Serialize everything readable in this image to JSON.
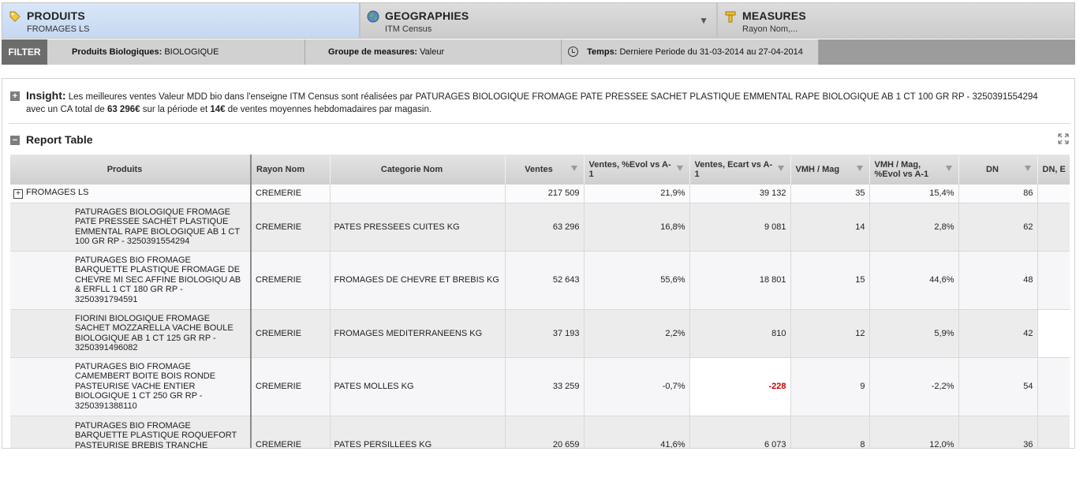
{
  "dimensions": {
    "produits": {
      "title": "PRODUITS",
      "sub": "FROMAGES LS"
    },
    "geographies": {
      "title": "GEOGRAPHIES",
      "sub": "ITM Census"
    },
    "measures": {
      "title": "MEASURES",
      "sub": "Rayon Nom,..."
    }
  },
  "filter": {
    "label": "FILTER",
    "bio_label": "Produits Biologiques:",
    "bio_value": "BIOLOGIQUE",
    "groupe_label": "Groupe de measures:",
    "groupe_value": "Valeur",
    "temps_label": "Temps:",
    "temps_value": "Derniere Periode du 31-03-2014 au 27-04-2014"
  },
  "insight": {
    "title": "Insight:",
    "text1": "Les meilleures ventes Valeur MDD bio dans l'enseigne ITM Census sont réalisées par PATURAGES BIOLOGIQUE FROMAGE PATE PRESSEE SACHET PLASTIQUE EMMENTAL RAPE BIOLOGIQUE AB 1 CT 100 GR RP - 3250391554294 avec un CA total de",
    "ca": "63 296€",
    "text2": "sur la période et",
    "weekly": "14€",
    "text3": "de ventes moyennes hebdomadaires par magasin."
  },
  "report": {
    "title": "Report Table",
    "columns": [
      "Produits",
      "Rayon Nom",
      "Categorie Nom",
      "Ventes",
      "Ventes, %Evol vs A-1",
      "Ventes, Ecart vs A-1",
      "VMH / Mag",
      "VMH / Mag, %Evol vs A-1",
      "DN",
      "DN, E"
    ],
    "top_row": {
      "produit": "FROMAGES LS",
      "rayon": "CREMERIE",
      "categorie": "",
      "ventes": "217 509",
      "evol": "21,9%",
      "ecart": "39 132",
      "vmh": "35",
      "vmh_evol": "15,4%",
      "dn": "86"
    },
    "rows": [
      {
        "produit": "PATURAGES BIOLOGIQUE FROMAGE PATE PRESSEE SACHET PLASTIQUE EMMENTAL RAPE BIOLOGIQUE AB 1 CT 100 GR RP - 3250391554294",
        "rayon": "CREMERIE",
        "categorie": "PATES PRESSEES CUITES KG",
        "ventes": "63 296",
        "evol": "16,8%",
        "ecart": "9 081",
        "vmh": "14",
        "vmh_evol": "2,8%",
        "dn": "62"
      },
      {
        "produit": "PATURAGES BIO FROMAGE BARQUETTE PLASTIQUE FROMAGE DE CHEVRE MI SEC AFFINE BIOLOGIQU AB & ERFLL 1 CT 180 GR RP - 3250391794591",
        "rayon": "CREMERIE",
        "categorie": "FROMAGES DE CHEVRE ET BREBIS KG",
        "ventes": "52 643",
        "evol": "55,6%",
        "ecart": "18 801",
        "vmh": "15",
        "vmh_evol": "44,6%",
        "dn": "48"
      },
      {
        "produit": "FIORINI BIOLOGIQUE FROMAGE SACHET MOZZARELLA VACHE BOULE BIOLOGIQUE AB 1 CT 125 GR RP - 3250391496082",
        "rayon": "CREMERIE",
        "categorie": "FROMAGES MEDITERRANEENS KG",
        "ventes": "37 193",
        "evol": "2,2%",
        "ecart": "810",
        "vmh": "12",
        "vmh_evol": "5,9%",
        "dn": "42"
      },
      {
        "produit": "PATURAGES BIO FROMAGE CAMEMBERT BOITE BOIS RONDE PASTEURISE VACHE ENTIER BIOLOGIQUE 1 CT 250 GR RP - 3250391388110",
        "rayon": "CREMERIE",
        "categorie": "PATES MOLLES KG",
        "ventes": "33 259",
        "evol": "-0,7%",
        "ecart": "-228",
        "vmh": "9",
        "vmh_evol": "-2,2%",
        "dn": "54"
      },
      {
        "produit": "PATURAGES BIO FROMAGE BARQUETTE PLASTIQUE ROQUEFORT PASTEURISE BREBIS TRANCHE",
        "rayon": "CREMERIE",
        "categorie": "PATES PERSILLEES KG",
        "ventes": "20 659",
        "evol": "41,6%",
        "ecart": "6 073",
        "vmh": "8",
        "vmh_evol": "12,0%",
        "dn": "36"
      }
    ]
  },
  "colors": {
    "tab_active": "#c5d8f1",
    "filter_dark": "#6c6c6c",
    "negative": "#cc0000"
  }
}
